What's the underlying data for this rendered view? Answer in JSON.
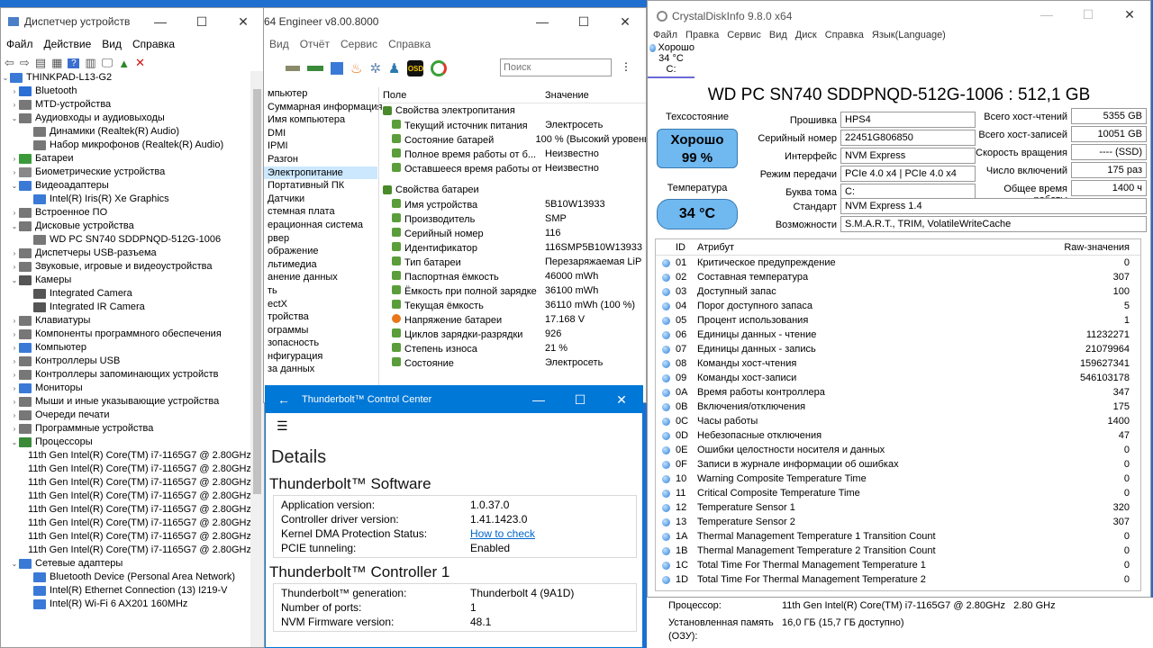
{
  "device_manager": {
    "title": "Диспетчер устройств",
    "menu": [
      "Файл",
      "Действие",
      "Вид",
      "Справка"
    ],
    "root": "THINKPAD-L13-G2",
    "items": [
      {
        "label": "Bluetooth",
        "level": 1,
        "exp": "›",
        "color": "#2b6fd6"
      },
      {
        "label": "MTD-устройства",
        "level": 1,
        "exp": "›",
        "color": "#777"
      },
      {
        "label": "Аудиовходы и аудиовыходы",
        "level": 1,
        "exp": "⌄",
        "color": "#777"
      },
      {
        "label": "Динамики (Realtek(R) Audio)",
        "level": 2,
        "exp": "",
        "color": "#777"
      },
      {
        "label": "Набор микрофонов (Realtek(R) Audio)",
        "level": 2,
        "exp": "",
        "color": "#777"
      },
      {
        "label": "Батареи",
        "level": 1,
        "exp": "›",
        "color": "#3a9a3a"
      },
      {
        "label": "Биометрические устройства",
        "level": 1,
        "exp": "›",
        "color": "#888"
      },
      {
        "label": "Видеоадаптеры",
        "level": 1,
        "exp": "⌄",
        "color": "#3a7ad6"
      },
      {
        "label": "Intel(R) Iris(R) Xe Graphics",
        "level": 2,
        "exp": "",
        "color": "#3a7ad6"
      },
      {
        "label": "Встроенное ПО",
        "level": 1,
        "exp": "›",
        "color": "#777"
      },
      {
        "label": "Дисковые устройства",
        "level": 1,
        "exp": "⌄",
        "color": "#777"
      },
      {
        "label": "WD PC SN740 SDDPNQD-512G-1006",
        "level": 2,
        "exp": "",
        "color": "#777"
      },
      {
        "label": "Диспетчеры USB-разъема",
        "level": 1,
        "exp": "›",
        "color": "#777"
      },
      {
        "label": "Звуковые, игровые и видеоустройства",
        "level": 1,
        "exp": "›",
        "color": "#777"
      },
      {
        "label": "Камеры",
        "level": 1,
        "exp": "⌄",
        "color": "#555"
      },
      {
        "label": "Integrated Camera",
        "level": 2,
        "exp": "",
        "color": "#555"
      },
      {
        "label": "Integrated IR Camera",
        "level": 2,
        "exp": "",
        "color": "#555"
      },
      {
        "label": "Клавиатуры",
        "level": 1,
        "exp": "›",
        "color": "#777"
      },
      {
        "label": "Компоненты программного обеспечения",
        "level": 1,
        "exp": "›",
        "color": "#777"
      },
      {
        "label": "Компьютер",
        "level": 1,
        "exp": "›",
        "color": "#3a7ad6"
      },
      {
        "label": "Контроллеры USB",
        "level": 1,
        "exp": "›",
        "color": "#777"
      },
      {
        "label": "Контроллеры запоминающих устройств",
        "level": 1,
        "exp": "›",
        "color": "#777"
      },
      {
        "label": "Мониторы",
        "level": 1,
        "exp": "›",
        "color": "#3a7ad6"
      },
      {
        "label": "Мыши и иные указывающие устройства",
        "level": 1,
        "exp": "›",
        "color": "#777"
      },
      {
        "label": "Очереди печати",
        "level": 1,
        "exp": "›",
        "color": "#777"
      },
      {
        "label": "Программные устройства",
        "level": 1,
        "exp": "›",
        "color": "#777"
      },
      {
        "label": "Процессоры",
        "level": 1,
        "exp": "⌄",
        "color": "#3a8a3a"
      },
      {
        "label": "11th Gen Intel(R) Core(TM) i7-1165G7 @ 2.80GHz",
        "level": 2,
        "exp": "",
        "color": "#3a8a3a"
      },
      {
        "label": "11th Gen Intel(R) Core(TM) i7-1165G7 @ 2.80GHz",
        "level": 2,
        "exp": "",
        "color": "#3a8a3a"
      },
      {
        "label": "11th Gen Intel(R) Core(TM) i7-1165G7 @ 2.80GHz",
        "level": 2,
        "exp": "",
        "color": "#3a8a3a"
      },
      {
        "label": "11th Gen Intel(R) Core(TM) i7-1165G7 @ 2.80GHz",
        "level": 2,
        "exp": "",
        "color": "#3a8a3a"
      },
      {
        "label": "11th Gen Intel(R) Core(TM) i7-1165G7 @ 2.80GHz",
        "level": 2,
        "exp": "",
        "color": "#3a8a3a"
      },
      {
        "label": "11th Gen Intel(R) Core(TM) i7-1165G7 @ 2.80GHz",
        "level": 2,
        "exp": "",
        "color": "#3a8a3a"
      },
      {
        "label": "11th Gen Intel(R) Core(TM) i7-1165G7 @ 2.80GHz",
        "level": 2,
        "exp": "",
        "color": "#3a8a3a"
      },
      {
        "label": "11th Gen Intel(R) Core(TM) i7-1165G7 @ 2.80GHz",
        "level": 2,
        "exp": "",
        "color": "#3a8a3a"
      },
      {
        "label": "Сетевые адаптеры",
        "level": 1,
        "exp": "⌄",
        "color": "#3a7ad6"
      },
      {
        "label": "Bluetooth Device (Personal Area Network)",
        "level": 2,
        "exp": "",
        "color": "#3a7ad6"
      },
      {
        "label": "Intel(R) Ethernet Connection (13) I219-V",
        "level": 2,
        "exp": "",
        "color": "#3a7ad6"
      },
      {
        "label": "Intel(R) Wi-Fi 6 AX201 160MHz",
        "level": 2,
        "exp": "",
        "color": "#3a7ad6"
      }
    ]
  },
  "aida": {
    "title": "64 Engineer v8.00.8000",
    "menu": [
      "Вид",
      "Отчёт",
      "Сервис",
      "Справка"
    ],
    "search_placeholder": "Поиск",
    "sidebar": [
      "мпьютер",
      "Суммарная информация",
      "Имя компьютера",
      "DMI",
      "IPMI",
      "Разгон",
      "Электропитание",
      "Портативный ПК",
      "Датчики",
      "стемная плата",
      "ерационная система",
      "рвер",
      "ображение",
      "льтимедиа",
      "анение данных",
      "ть",
      "ectX",
      "тройства",
      "ограммы",
      "зопасность",
      "нфигурация",
      "за данных"
    ],
    "sidebar_selected": 6,
    "col_field": "Поле",
    "col_value": "Значение",
    "sections": [
      {
        "title": "Свойства электропитания",
        "rows": [
          {
            "k": "Текущий источник питания",
            "v": "Электросеть"
          },
          {
            "k": "Состояние батарей",
            "v": "100 % (Высокий уровень)"
          },
          {
            "k": "Полное время работы от б...",
            "v": "Неизвестно"
          },
          {
            "k": "Оставшееся время работы от ...",
            "v": "Неизвестно"
          }
        ]
      },
      {
        "title": "Свойства батареи",
        "rows": [
          {
            "k": "Имя устройства",
            "v": "5B10W13933"
          },
          {
            "k": "Производитель",
            "v": "SMP"
          },
          {
            "k": "Серийный номер",
            "v": "116"
          },
          {
            "k": "Идентификатор",
            "v": "116SMP5B10W13933"
          },
          {
            "k": "Тип батареи",
            "v": "Перезаряжаемая LiP"
          },
          {
            "k": "Паспортная ёмкость",
            "v": "46000 mWh"
          },
          {
            "k": "Ёмкость при полной зарядке",
            "v": "36100 mWh"
          },
          {
            "k": "Текущая ёмкость",
            "v": "36110 mWh  (100 %)"
          },
          {
            "k": "Напряжение батареи",
            "v": "17.168 V"
          },
          {
            "k": "Циклов зарядки-разрядки",
            "v": "926"
          },
          {
            "k": "Степень износа",
            "v": "21 %"
          },
          {
            "k": "Состояние",
            "v": "Электросеть"
          }
        ]
      }
    ]
  },
  "thunderbolt": {
    "title": "Thunderbolt™ Control Center",
    "page_title": "Details",
    "software_header": "Thunderbolt™ Software",
    "software": [
      {
        "k": "Application version:",
        "v": "1.0.37.0"
      },
      {
        "k": "Controller driver version:",
        "v": "1.41.1423.0"
      },
      {
        "k": "Kernel DMA Protection Status:",
        "v": "How to check",
        "link": true
      },
      {
        "k": "PCIE tunneling:",
        "v": "Enabled"
      }
    ],
    "controller_header": "Thunderbolt™ Controller 1",
    "controller": [
      {
        "k": "Thunderbolt™ generation:",
        "v": "Thunderbolt 4 (9A1D)"
      },
      {
        "k": "Number of ports:",
        "v": "1"
      },
      {
        "k": "NVM Firmware version:",
        "v": "48.1"
      }
    ]
  },
  "crystal": {
    "title": "CrystalDiskInfo 9.8.0 x64",
    "menu": [
      "Файл",
      "Правка",
      "Сервис",
      "Вид",
      "Диск",
      "Справка",
      "Язык(Language)"
    ],
    "tab_status": "Хорошо",
    "tab_temp": "34 °C",
    "tab_drive": "C:",
    "model": "WD PC SN740 SDDPNQD-512G-1006 : 512,1 GB",
    "health_label": "Техсостояние",
    "health_text": "Хорошо",
    "health_pct": "99 %",
    "temp_label": "Температура",
    "temp_value": "34 °C",
    "left_fields": [
      {
        "k": "Прошивка",
        "v": "HPS4"
      },
      {
        "k": "Серийный номер",
        "v": "22451G806850"
      },
      {
        "k": "Интерфейс",
        "v": "NVM Express"
      },
      {
        "k": "Режим передачи",
        "v": "PCIe 4.0 x4 | PCIe 4.0 x4"
      },
      {
        "k": "Буква тома",
        "v": "C:"
      }
    ],
    "right_fields": [
      {
        "k": "Всего хост-чтений",
        "v": "5355 GB"
      },
      {
        "k": "Всего хост-записей",
        "v": "10051 GB"
      },
      {
        "k": "Скорость вращения",
        "v": "---- (SSD)"
      },
      {
        "k": "Число включений",
        "v": "175 раз"
      },
      {
        "k": "Общее время работы",
        "v": "1400 ч"
      }
    ],
    "standard_label": "Стандарт",
    "standard_value": "NVM Express 1.4",
    "features_label": "Возможности",
    "features_value": "S.M.A.R.T., TRIM, VolatileWriteCache",
    "col_id": "ID",
    "col_attr": "Атрибут",
    "col_raw": "Raw-значения",
    "attributes": [
      {
        "id": "01",
        "name": "Критическое предупреждение",
        "raw": "0"
      },
      {
        "id": "02",
        "name": "Составная температура",
        "raw": "307"
      },
      {
        "id": "03",
        "name": "Доступный запас",
        "raw": "100"
      },
      {
        "id": "04",
        "name": "Порог доступного запаса",
        "raw": "5"
      },
      {
        "id": "05",
        "name": "Процент использования",
        "raw": "1"
      },
      {
        "id": "06",
        "name": "Единицы данных - чтение",
        "raw": "11232271"
      },
      {
        "id": "07",
        "name": "Единицы данных - запись",
        "raw": "21079964"
      },
      {
        "id": "08",
        "name": "Команды хост-чтения",
        "raw": "159627341"
      },
      {
        "id": "09",
        "name": "Команды хост-записи",
        "raw": "546103178"
      },
      {
        "id": "0A",
        "name": "Время работы контроллера",
        "raw": "347"
      },
      {
        "id": "0B",
        "name": "Включения/отключения",
        "raw": "175"
      },
      {
        "id": "0C",
        "name": "Часы работы",
        "raw": "1400"
      },
      {
        "id": "0D",
        "name": "Небезопасные отключения",
        "raw": "47"
      },
      {
        "id": "0E",
        "name": "Ошибки целостности носителя и данных",
        "raw": "0"
      },
      {
        "id": "0F",
        "name": "Записи в журнале информации об ошибках",
        "raw": "0"
      },
      {
        "id": "10",
        "name": "Warning Composite Temperature Time",
        "raw": "0"
      },
      {
        "id": "11",
        "name": "Critical Composite Temperature Time",
        "raw": "0"
      },
      {
        "id": "12",
        "name": "Temperature Sensor 1",
        "raw": "320"
      },
      {
        "id": "13",
        "name": "Temperature Sensor 2",
        "raw": "307"
      },
      {
        "id": "1A",
        "name": "Thermal Management Temperature 1 Transition Count",
        "raw": "0"
      },
      {
        "id": "1B",
        "name": "Thermal Management Temperature 2 Transition Count",
        "raw": "0"
      },
      {
        "id": "1C",
        "name": "Total Time For Thermal Management Temperature 1",
        "raw": "0"
      },
      {
        "id": "1D",
        "name": "Total Time For Thermal Management Temperature 2",
        "raw": "0"
      }
    ]
  },
  "sysinfo": {
    "cpu_label": "Процессор:",
    "cpu_value": "11th Gen Intel(R) Core(TM) i7-1165G7 @ 2.80GHz   2.80 GHz",
    "ram_label": "Установленная память",
    "ram_label2": "(ОЗУ):",
    "ram_value": "16,0 ГБ (15,7 ГБ доступно)"
  },
  "colors": {
    "accent": "#0078d7",
    "health_bg": "#6fb8f0",
    "link": "#0066cc"
  }
}
